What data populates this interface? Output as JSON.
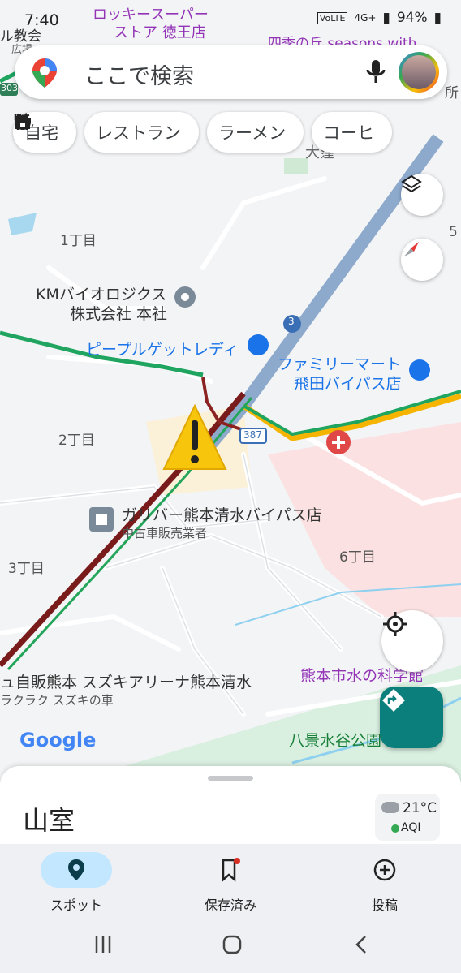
{
  "status_bar": {
    "time": "7:40",
    "battery": "94%",
    "network": "4G+",
    "volte": "VoLTE"
  },
  "search": {
    "placeholder": "ここで検索"
  },
  "chips": [
    {
      "icon": "home-icon",
      "label": "自宅"
    },
    {
      "icon": "restaurant-icon",
      "label": "レストラン"
    },
    {
      "icon": "ramen-icon",
      "label": "ラーメン"
    },
    {
      "icon": "coffee-icon",
      "label": "コーヒ"
    }
  ],
  "map_labels": {
    "top_left_1": "ル教会",
    "top_left_2": "広場",
    "lucky": "ロッキースーパー",
    "lucky2": "ストア 徳王店",
    "seasons": "四季の丘 seasons with",
    "route_303": "303",
    "district_top": "大窪",
    "chome1": "1丁目",
    "km_bio": "KMバイオロジクス",
    "km_bio2": "株式会社 本社",
    "peoples": "ピープルゲットレディ",
    "route_3": "3",
    "familymart": "ファミリーマート",
    "familymart2": "飛田バイパス店",
    "route_387": "387",
    "chome2": "2丁目",
    "gulliver": "ガリバー熊本清水バイパス店",
    "gulliver_sub": "中古車販売業者",
    "chome3": "3丁目",
    "chome6": "6丁目",
    "suzuki": "ュ自販熊本 スズキアリーナ熊本清水",
    "suzuki_sub": "ラクラク スズキの車",
    "mizu": "熊本市水の科学館",
    "hakkei": "八景水谷公園",
    "google": "Google",
    "edge_5": "5",
    "edge_office": "所"
  },
  "sheet": {
    "place": "山室",
    "temperature": "21°C",
    "aqi": "AQI"
  },
  "nav": [
    {
      "label": "スポット",
      "active": true
    },
    {
      "label": "保存済み",
      "active": false
    },
    {
      "label": "投稿",
      "active": false
    }
  ]
}
